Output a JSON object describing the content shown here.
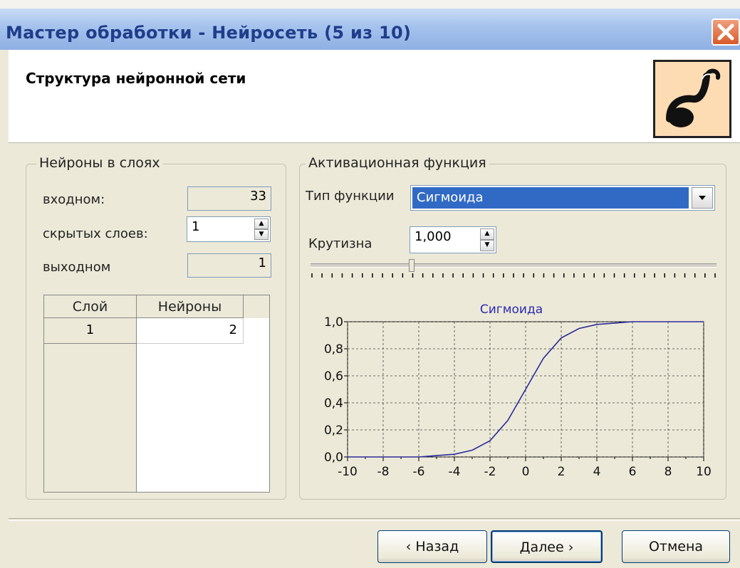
{
  "window": {
    "title": "Мастер обработки - Нейросеть (5 из 10)",
    "header_title": "Структура нейронной сети"
  },
  "neurons_group": {
    "title": "Нейроны в слоях",
    "input_label": "входном:",
    "input_value": "33",
    "hidden_label": "скрытых слоев:",
    "hidden_value": "1",
    "output_label": "выходном",
    "output_value": "1",
    "table": {
      "columns": [
        "Слой",
        "Нейроны"
      ],
      "rows": [
        {
          "layer": "1",
          "neurons": "2"
        }
      ]
    }
  },
  "activation_group": {
    "title": "Активационная функция",
    "type_label": "Тип функции",
    "type_value": "Сигмоида",
    "steepness_label": "Крутизна",
    "steepness_value": "1,000",
    "slider_value": 1.0
  },
  "chart_data": {
    "type": "line",
    "title": "Сигмоида",
    "xlim": [
      -10,
      10
    ],
    "ylim": [
      0,
      1
    ],
    "x_ticks": [
      "-10",
      "-8",
      "-6",
      "-4",
      "-2",
      "0",
      "2",
      "4",
      "6",
      "8",
      "10"
    ],
    "y_ticks": [
      "0,0",
      "0,2",
      "0,4",
      "0,6",
      "0,8",
      "1,0"
    ],
    "grid": true,
    "x": [
      -10,
      -8,
      -6,
      -5,
      -4,
      -3,
      -2,
      -1,
      0,
      1,
      2,
      3,
      4,
      5,
      6,
      8,
      10
    ],
    "y": [
      0.0,
      0.0,
      0.0,
      0.01,
      0.02,
      0.05,
      0.12,
      0.27,
      0.5,
      0.73,
      0.88,
      0.95,
      0.98,
      0.99,
      1.0,
      1.0,
      1.0
    ],
    "line_color": "#2b2b9b",
    "title_color": "#2b2bb0"
  },
  "buttons": {
    "back": "‹ Назад",
    "next": "Далее ›",
    "cancel": "Отмена"
  },
  "colors": {
    "title_text": "#1f3d8a",
    "selection": "#316ac5",
    "dialog_bg": "#ece9d8"
  }
}
